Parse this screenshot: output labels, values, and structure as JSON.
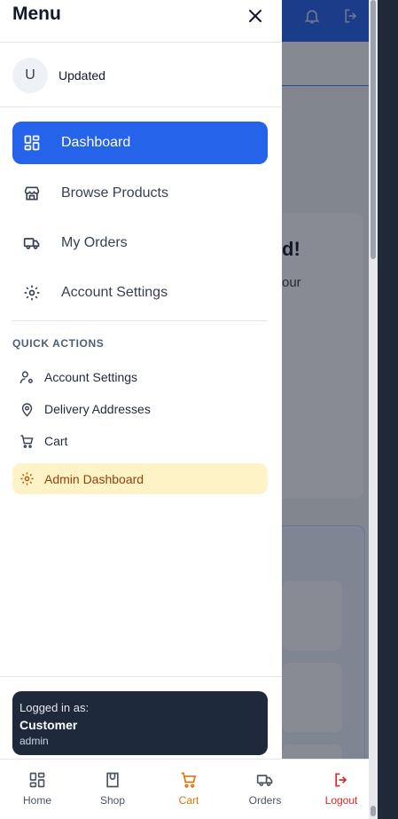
{
  "drawer": {
    "title": "Menu",
    "close_icon": "close-icon",
    "user": {
      "avatar_initial": "U",
      "name": "Updated"
    }
  },
  "nav": [
    {
      "label": "Dashboard",
      "icon": "grid-icon",
      "active": true
    },
    {
      "label": "Browse Products",
      "icon": "store-icon",
      "active": false
    },
    {
      "label": "My Orders",
      "icon": "truck-icon",
      "active": false
    },
    {
      "label": "Account Settings",
      "icon": "gear-icon",
      "active": false
    }
  ],
  "quick_actions": {
    "title": "QUICK ACTIONS",
    "items": [
      {
        "label": "Account Settings",
        "icon": "user-gear-icon"
      },
      {
        "label": "Delivery Addresses",
        "icon": "map-pin-icon"
      },
      {
        "label": "Cart",
        "icon": "cart-icon"
      },
      {
        "label": "Admin Dashboard",
        "icon": "gear-icon"
      }
    ]
  },
  "login": {
    "prefix": "Logged in as:",
    "role": "Customer",
    "username": "admin"
  },
  "bottom_nav": [
    {
      "label": "Home",
      "icon": "grid-icon"
    },
    {
      "label": "Shop",
      "icon": "bag-icon"
    },
    {
      "label": "Cart",
      "icon": "cart-icon"
    },
    {
      "label": "Orders",
      "icon": "truck-icon"
    },
    {
      "label": "Logout",
      "icon": "logout-icon"
    }
  ],
  "background": {
    "heading_fragment": "d!",
    "sub_fragment": "our"
  },
  "colors": {
    "primary": "#2563eb",
    "admin_bg": "#fef3c7",
    "cart_accent": "#d97706",
    "logout_accent": "#dc2626",
    "login_card": "#1e293b"
  }
}
